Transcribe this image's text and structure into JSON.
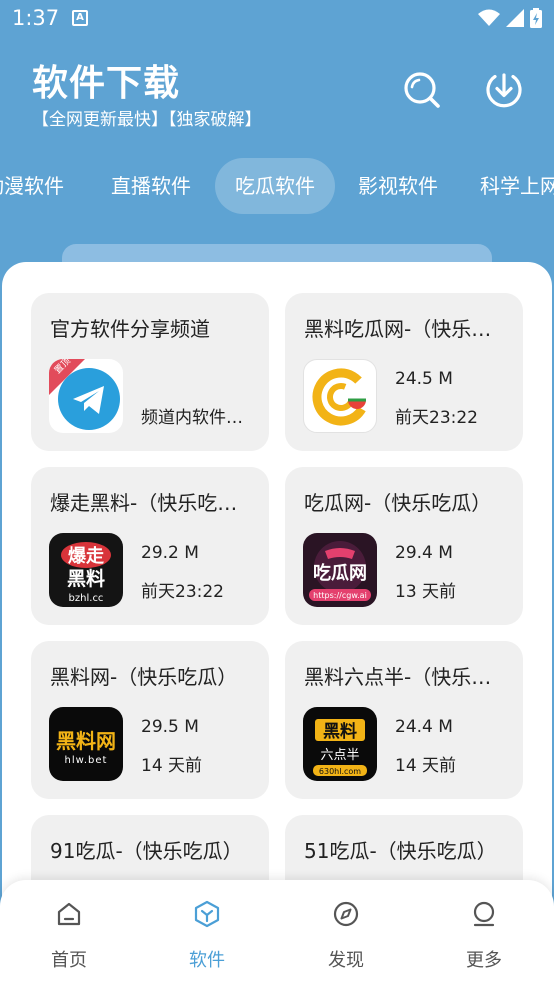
{
  "status": {
    "time": "1:37",
    "badge": "A"
  },
  "header": {
    "title": "软件下载",
    "subtitle": "【全网更新最快】【独家破解】"
  },
  "tabs": [
    "动漫软件",
    "直播软件",
    "吃瓜软件",
    "影视软件",
    "科学上网"
  ],
  "active_tab": "吃瓜软件",
  "cards": [
    {
      "title": "官方软件分享频道",
      "desc": "频道内软件…",
      "icon": "telegram-icon",
      "pin": "置顶"
    },
    {
      "title": "黑料吃瓜网-（快乐吃瓜）",
      "size": "24.5 M",
      "date": "前天23:22",
      "icon": "cg-watermelon-logo"
    },
    {
      "title": "爆走黑料-（快乐吃瓜）",
      "size": "29.2 M",
      "date": "前天23:22",
      "icon": "bzhl-logo",
      "logo_text": [
        "爆走",
        "黑料",
        "bzhl.cc"
      ]
    },
    {
      "title": "吃瓜网-（快乐吃瓜）",
      "size": "29.4 M",
      "date": "13 天前",
      "icon": "cgw-logo",
      "logo_text": [
        "吃瓜网",
        "https://cgw.ai"
      ]
    },
    {
      "title": "黑料网-（快乐吃瓜）",
      "size": "29.5 M",
      "date": "14 天前",
      "icon": "hlw-logo",
      "logo_text": [
        "黑料网",
        "hlw.bet"
      ]
    },
    {
      "title": "黑料六点半-（快乐吃瓜）",
      "size": "24.4 M",
      "date": "14 天前",
      "icon": "630hl-logo",
      "logo_text": [
        "黑料",
        "六点半",
        "630hl.com"
      ]
    },
    {
      "title": "91吃瓜-（快乐吃瓜）"
    },
    {
      "title": "51吃瓜-（快乐吃瓜）"
    }
  ],
  "nav": [
    {
      "label": "首页",
      "icon": "home-icon"
    },
    {
      "label": "软件",
      "icon": "apps-icon"
    },
    {
      "label": "发现",
      "icon": "compass-icon"
    },
    {
      "label": "更多",
      "icon": "profile-icon"
    }
  ],
  "active_nav": "软件",
  "colors": {
    "header_bg": "#5ea3d3",
    "card_bg": "#f0f0f0",
    "accent": "#4b9fd6",
    "text": "#222222"
  }
}
